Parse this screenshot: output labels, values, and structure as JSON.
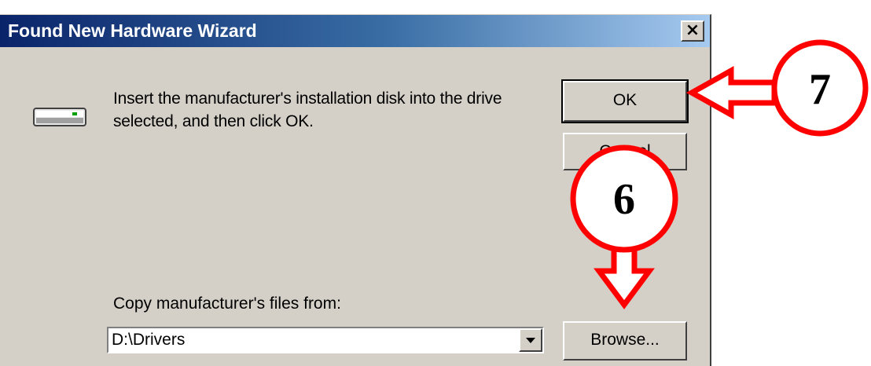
{
  "window": {
    "title": "Found New Hardware Wizard",
    "close_label": "×"
  },
  "icons": {
    "drive": "disk-drive-icon",
    "close": "close-icon",
    "dropdown": "chevron-down-icon"
  },
  "message": {
    "line1": "Insert the manufacturer's installation disk into the drive",
    "line2": "selected, and then click OK."
  },
  "buttons": {
    "ok_label": "OK",
    "cancel_label": "Cancel",
    "browse_label": "Browse..."
  },
  "copy_from": {
    "label": "Copy manufacturer's files from:",
    "value": "D:\\Drivers"
  },
  "annotations": {
    "step_ok": "7",
    "step_browse": "6",
    "color": "#ff0000"
  },
  "colors": {
    "titlebar_start": "#0a246a",
    "titlebar_end": "#a6caf0",
    "dialog_bg": "#d4d0c8"
  }
}
